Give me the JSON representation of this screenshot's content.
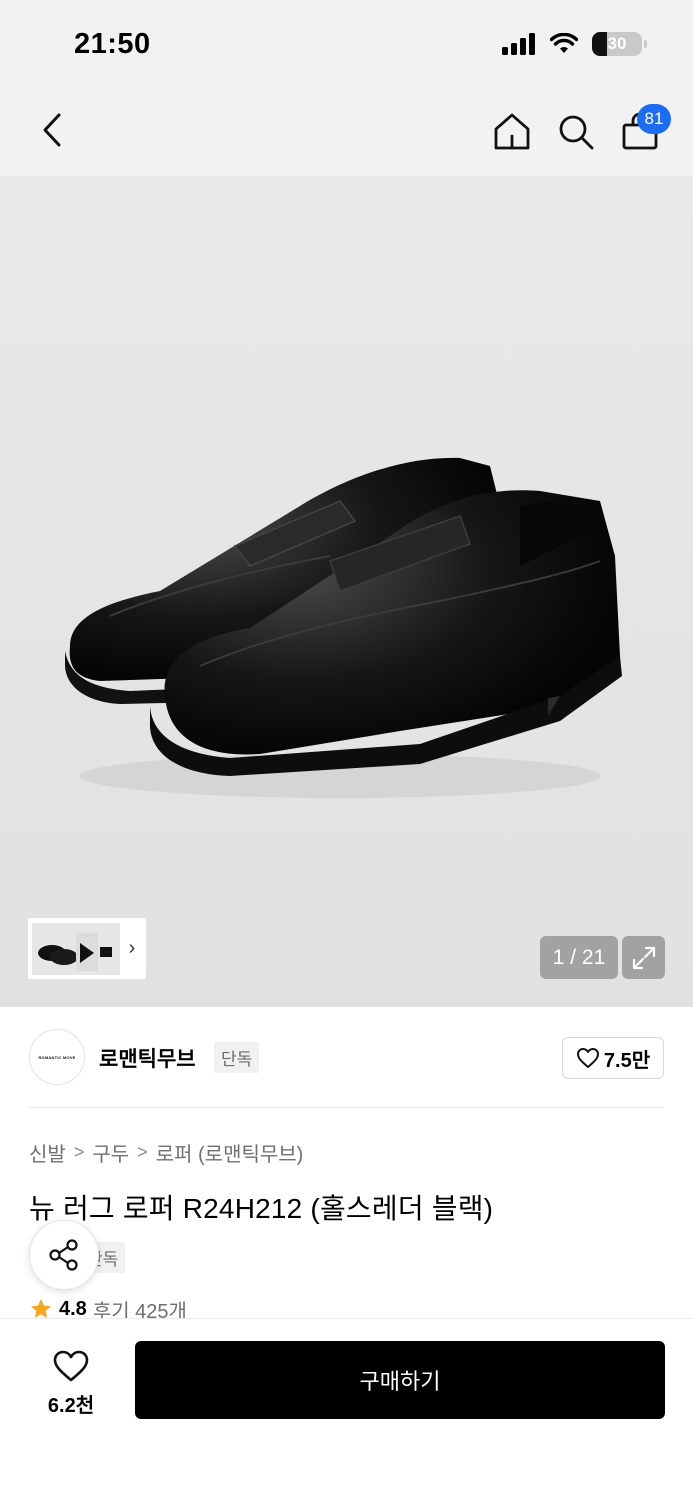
{
  "status_bar": {
    "time": "21:50",
    "battery_percent": "30"
  },
  "nav": {
    "cart_count": "81"
  },
  "gallery": {
    "page_counter": "1 / 21"
  },
  "brand": {
    "logo_text": "ROMANTIC MOVE",
    "name": "로맨틱무브",
    "tag": "단독",
    "like_count": "7.5만"
  },
  "breadcrumb": [
    "신발",
    "구두",
    "로퍼 (로맨틱무브)"
  ],
  "product": {
    "title": "뉴 러그 로퍼 R24H212 (홀스레더 블랙)",
    "tag": "단독",
    "rating": "4.8",
    "review_text": "후기 425개"
  },
  "bottom_bar": {
    "wish_count": "6.2천",
    "buy_label": "구매하기"
  },
  "icons": [
    "back-chevron",
    "home",
    "search",
    "shopping-bag",
    "expand",
    "heart",
    "share",
    "star"
  ]
}
